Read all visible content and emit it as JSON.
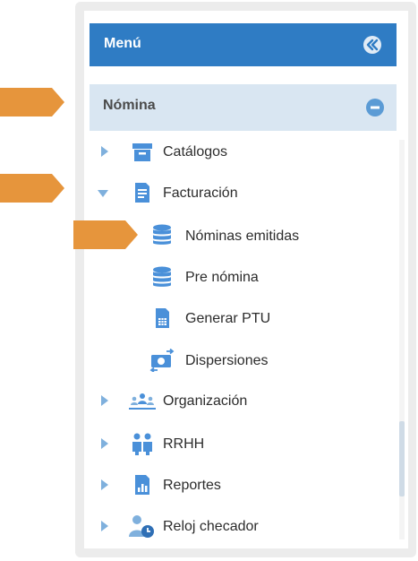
{
  "menu": {
    "title": "Menú"
  },
  "section": {
    "title": "Nómina"
  },
  "items": {
    "catalogos": "Catálogos",
    "facturacion": "Facturación",
    "nominas_emitidas": "Nóminas emitidas",
    "pre_nomina": "Pre nómina",
    "generar_ptu": "Generar PTU",
    "dispersiones": "Dispersiones",
    "organizacion": "Organización",
    "rrhh": "RRHH",
    "reportes": "Reportes",
    "reloj_checador": "Reloj checador"
  },
  "colors": {
    "accent": "#2f7cc4",
    "section_bg": "#d9e6f2",
    "callout": "#e6953c",
    "icon_blue": "#4a90d9"
  }
}
